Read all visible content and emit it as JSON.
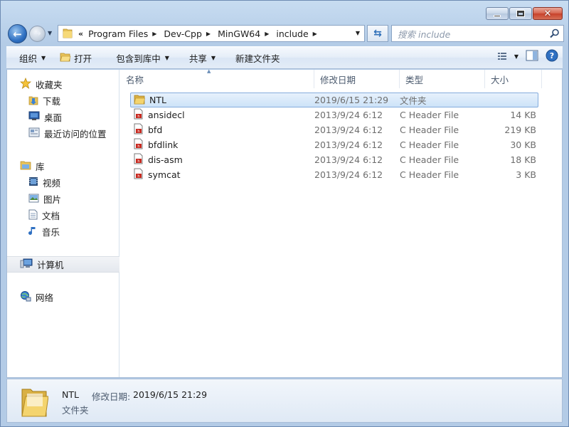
{
  "window": {
    "caption_buttons": {
      "minimize": "minimize",
      "maximize": "maximize",
      "close": "close"
    }
  },
  "address_bar": {
    "overflow": "«",
    "breadcrumbs": [
      "Program Files",
      "Dev-Cpp",
      "MinGW64",
      "include"
    ]
  },
  "search": {
    "placeholder": "搜索 include"
  },
  "toolbar": {
    "organize": "组织",
    "open": "打开",
    "include_in_library": "包含到库中",
    "share": "共享",
    "new_folder": "新建文件夹"
  },
  "nav": {
    "favorites": "收藏夹",
    "favorites_items": [
      "下载",
      "桌面",
      "最近访问的位置"
    ],
    "libraries": "库",
    "libraries_items": [
      "视频",
      "图片",
      "文档",
      "音乐"
    ],
    "computer": "计算机",
    "network": "网络"
  },
  "columns": {
    "name": "名称",
    "modified": "修改日期",
    "type": "类型",
    "size": "大小"
  },
  "files": [
    {
      "name": "NTL",
      "modified": "2019/6/15 21:29",
      "type": "文件夹",
      "size": "",
      "kind": "folder",
      "selected": true
    },
    {
      "name": "ansidecl",
      "modified": "2013/9/24 6:12",
      "type": "C Header File",
      "size": "14 KB",
      "kind": "header"
    },
    {
      "name": "bfd",
      "modified": "2013/9/24 6:12",
      "type": "C Header File",
      "size": "219 KB",
      "kind": "header"
    },
    {
      "name": "bfdlink",
      "modified": "2013/9/24 6:12",
      "type": "C Header File",
      "size": "30 KB",
      "kind": "header"
    },
    {
      "name": "dis-asm",
      "modified": "2013/9/24 6:12",
      "type": "C Header File",
      "size": "18 KB",
      "kind": "header"
    },
    {
      "name": "symcat",
      "modified": "2013/9/24 6:12",
      "type": "C Header File",
      "size": "3 KB",
      "kind": "header"
    }
  ],
  "details": {
    "name": "NTL",
    "modified_label": "修改日期:",
    "modified": "2019/6/15 21:29",
    "type": "文件夹"
  },
  "colors": {
    "selection": "#cde3f8",
    "selection_border": "#84acdd",
    "accent": "#2f70c2"
  }
}
